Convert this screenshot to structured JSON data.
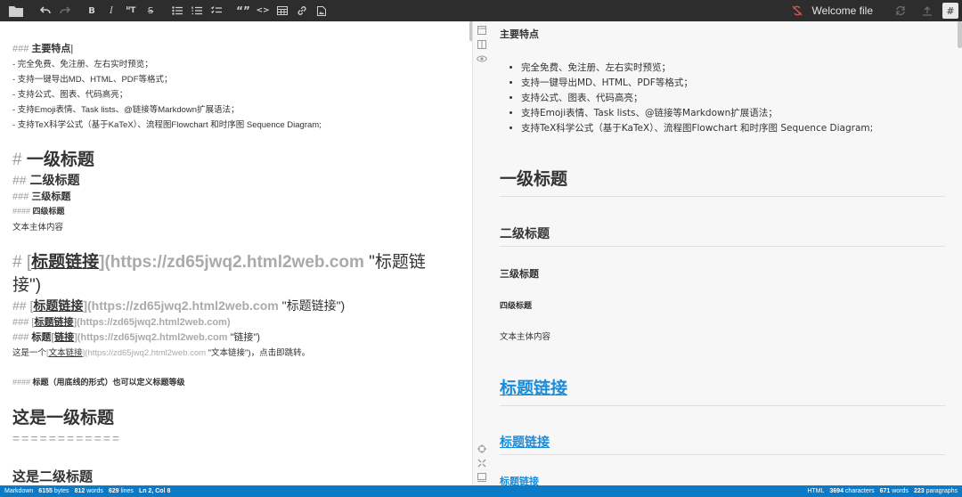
{
  "toolbar": {
    "doc_title": "Welcome file",
    "hash_label": "#",
    "icons": [
      "folder-icon",
      "undo-icon",
      "redo-icon",
      "bold-icon",
      "italic-icon",
      "heading-icon",
      "strikethrough-icon",
      "bulleted-list-icon",
      "numbered-list-icon",
      "checklist-icon",
      "quote-icon",
      "code-icon",
      "table-icon",
      "link-icon",
      "image-icon",
      "sync-off-icon",
      "sync-icon",
      "publish-icon",
      "markdown-menu-icon"
    ],
    "bold": "B",
    "italic": "I",
    "heading": "ᴴT",
    "strike": "S",
    "quote": "“”",
    "code": "<>"
  },
  "editor": {
    "l1_mark": "### ",
    "l1_text": "主要特点",
    "items": [
      "- 完全免费、免注册、左右实时预览；",
      "- 支持一键导出MD、HTML、PDF等格式；",
      "- 支持公式、图表、代码高亮；",
      "- 支持Emoji表情、Task lists、@链接等Markdown扩展语法；",
      "- 支持TeX科学公式（基于KaTeX）、流程图Flowchart 和时序图 Sequence Diagram;"
    ],
    "h1_mark": "# ",
    "h1_text": "一级标题",
    "h2_mark": "## ",
    "h2_text": "二级标题",
    "h3_mark": "### ",
    "h3_text": "三级标题",
    "h4_mark": "#### ",
    "h4_text": "四级标题",
    "body_text": "文本主体内容",
    "link_h1_mark": "# [",
    "link_h1_text": "标题链接",
    "link_h1_url": "](https://zd65jwq2.html2web.com ",
    "link_h1_title": "\"标题链",
    "link_h1_title2": "接\")",
    "link_h2_mark": "## [",
    "link_h2_text": "标题链接",
    "link_h2_url": "](https://zd65jwq2.html2web.com ",
    "link_h2_title": "\"标题链接\")",
    "link_h3a_mark": "### [",
    "link_h3a_text": "标题链接",
    "link_h3a_url": "](https://zd65jwq2.html2web.com)",
    "link_h3b_mark": "### ",
    "link_h3b_pre": "标题",
    "link_h3b_br": "[",
    "link_h3b_text": "链接",
    "link_h3b_url": "](https://zd65jwq2.html2web.com ",
    "link_h3b_title": "\"链接\")",
    "text_link_pre": "这是一个",
    "text_link_br": "[",
    "text_link_text": "文本链接",
    "text_link_url": "](https://zd65jwq2.html2web.com ",
    "text_link_title": "\"文本链接\")",
    "text_link_post": "，点击即跳转。",
    "setext_note_mark": "#### ",
    "setext_note": "标题（用底线的形式）也可以定义标题等级",
    "setext_h1": "这是一级标题",
    "setext_h1_rule": "============",
    "setext_h2": "这是二级标题"
  },
  "gutter": {
    "icons": [
      "editor-only-icon",
      "side-by-side-icon",
      "preview-only-icon",
      "scroll-sync-icon",
      "toggle-toolbar-icon",
      "toggle-status-icon"
    ]
  },
  "preview": {
    "h3": "主要特点",
    "items": [
      "完全免费、免注册、左右实时预览；",
      "支持一键导出MD、HTML、PDF等格式；",
      "支持公式、图表、代码高亮；",
      "支持Emoji表情、Task lists、@链接等Markdown扩展语法；",
      "支持TeX科学公式（基于KaTeX）、流程图Flowchart 和时序图 Sequence Diagram;"
    ],
    "h1": "一级标题",
    "h2": "二级标题",
    "h3b": "三级标题",
    "h4": "四级标题",
    "body_text": "文本主体内容",
    "link_h1": "标题链接",
    "link_h2": "标题链接",
    "link_h3": "标题链接"
  },
  "status": {
    "mode": "Markdown",
    "bytes": "6155",
    "bytes_label": "bytes",
    "words": "812",
    "words_label": "words",
    "lines": "629",
    "lines_label": "lines",
    "pos": "Ln 2, Col 8",
    "html_label": "HTML",
    "chars": "3694",
    "chars_label": "characters",
    "html_words": "671",
    "html_words_label": "words",
    "paragraphs": "223",
    "paragraphs_label": "paragraphs"
  },
  "colors": {
    "toolbar_bg": "#2d2d2d",
    "status_bg": "#0c7ac7",
    "link": "#1d8cd8",
    "sync_off": "#d9534f"
  }
}
